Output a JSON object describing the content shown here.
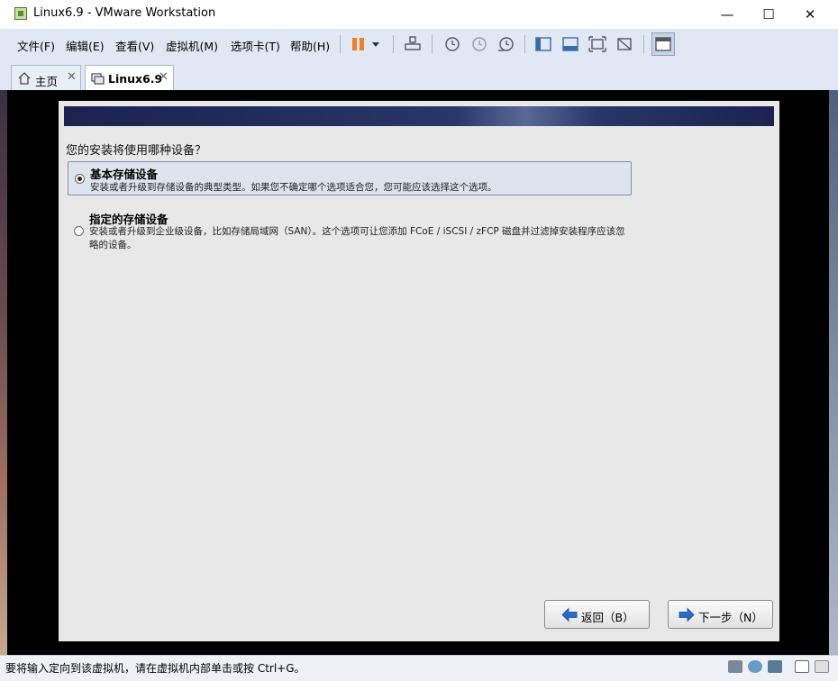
{
  "window": {
    "title": "Linux6.9 - VMware Workstation",
    "minimize_icon": "—",
    "maximize_icon": "☐",
    "close_icon": "✕"
  },
  "menubar": {
    "items": [
      "文件(F)",
      "编辑(E)",
      "查看(V)",
      "虚拟机(M)",
      "选项卡(T)",
      "帮助(H)"
    ]
  },
  "tabs": [
    {
      "label": "主页"
    },
    {
      "label": "Linux6.9"
    }
  ],
  "installer": {
    "question": "您的安装将使用哪种设备？",
    "options": [
      {
        "title": "基本存储设备",
        "desc": "安装或者升级到存储设备的典型类型。如果您不确定哪个选项适合您，您可能应该选择这个选项。",
        "selected": true
      },
      {
        "title": "指定的存储设备",
        "desc": "安装或者升级到企业级设备，比如存储局域网（SAN）。这个选项可让您添加 FCoE / iSCSI / zFCP 磁盘并过滤掉安装程序应该忽略的设备。",
        "selected": false
      }
    ],
    "back_label": "返回（B）",
    "next_label": "下一步（N）"
  },
  "status": {
    "text": "要将输入定向到该虚拟机，请在虚拟机内部单击或按 Ctrl+G。"
  },
  "colors": {
    "menubar_bg": "#dfe8f3",
    "pause_orange": "#f08020",
    "banner_navy": "#1a2350",
    "arrow_blue": "#2a6ac8"
  }
}
